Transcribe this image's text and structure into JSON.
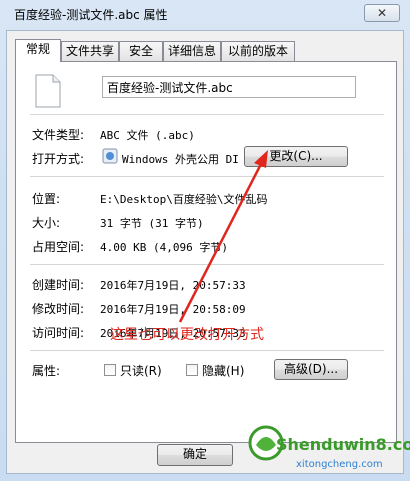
{
  "window": {
    "title": "百度经验-测试文件.abc 属性",
    "close_glyph": "✕"
  },
  "tabs": [
    {
      "label": "常规",
      "active": true
    },
    {
      "label": "文件共享",
      "active": false
    },
    {
      "label": "安全",
      "active": false
    },
    {
      "label": "详细信息",
      "active": false
    },
    {
      "label": "以前的版本",
      "active": false
    }
  ],
  "general": {
    "file_name": "百度经验-测试文件.abc",
    "file_type_label": "文件类型:",
    "file_type_value": "ABC 文件 (.abc)",
    "open_with_label": "打开方式:",
    "open_with_value": "Windows 外壳公用 DI",
    "change_button": "更改(C)...",
    "location_label": "位置:",
    "location_value": "E:\\Desktop\\百度经验\\文件乱码",
    "size_label": "大小:",
    "size_value": "31 字节 (31 字节)",
    "size_on_disk_label": "占用空间:",
    "size_on_disk_value": "4.00 KB (4,096 字节)",
    "created_label": "创建时间:",
    "created_value": "2016年7月19日, 20:57:33",
    "modified_label": "修改时间:",
    "modified_value": "2016年7月19日, 20:58:09",
    "accessed_label": "访问时间:",
    "accessed_value": "2016年7月19日, 20:57:33",
    "attributes_label": "属性:",
    "readonly_label": "只读(R)",
    "hidden_label": "隐藏(H)",
    "advanced_button": "高级(D)..."
  },
  "annotation": {
    "text": "这里也可以更改打开方式",
    "color": "#e0271e"
  },
  "footer": {
    "ok_button": "确定"
  },
  "watermark": {
    "main": "Shenduwin8.com",
    "sub": "xitongcheng.com"
  }
}
